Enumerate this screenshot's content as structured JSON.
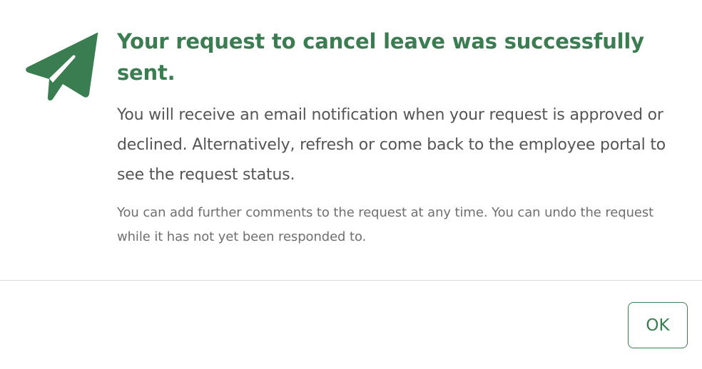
{
  "dialog": {
    "icon": "paper-plane-icon",
    "accent_color": "#3a7d50",
    "title": "Your request to cancel leave was successfully sent.",
    "message": "You will receive an email notification when your request is approved or declined. Alternatively, refresh or come back to the employee portal to see the request status.",
    "note": "You can add further comments to the request at any time. You can undo the request while it has not yet been responded to.",
    "ok_label": "OK"
  }
}
